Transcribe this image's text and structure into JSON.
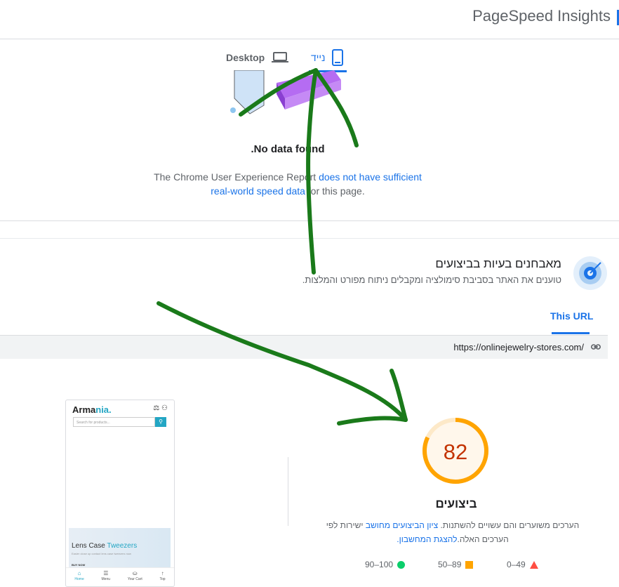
{
  "header": {
    "title": "PageSpeed Insights"
  },
  "device_tabs": {
    "desktop_label": "Desktop",
    "mobile_label": "נייד",
    "selected": "mobile"
  },
  "field_data": {
    "no_data_title": "No data found.",
    "crux_text_1": "The Chrome User Experience Report ",
    "crux_link": "does not have sufficient real-world speed data",
    "crux_text_2": " for this page."
  },
  "diagnose": {
    "title": "מאבחנים בעיות בביצועים",
    "subtitle": "טוענים את האתר בסביבת סימולציה ומקבלים ניתוח מפורט והמלצות."
  },
  "url_tabs": {
    "this_url": "This URL"
  },
  "url_bar": {
    "url": "https://onlinejewelry-stores.com/"
  },
  "thumbnail": {
    "brand_main": "Arma",
    "brand_accent": "nia.",
    "search_placeholder": "Search for products...",
    "banner_title_1": "Lens Case ",
    "banner_title_2": "Tweezers",
    "banner_sub": "Easier close up contact lens case tweezers now",
    "banner_cta": "BUY NOW",
    "nav": [
      "Home",
      "Menu",
      "Your Cart",
      "Top"
    ]
  },
  "score": {
    "value": "82",
    "fraction": 0.82,
    "label": "ביצועים",
    "note_1": "הערכים משוערים והם עשויים להשתנות. ",
    "note_link_1": "ציון הביצועים מחושב",
    "note_2": " ישירות לפי הערכים האלה.",
    "note_link_2": "להצגת המחשבון."
  },
  "legend": {
    "good": "90–100",
    "average": "50–89",
    "poor": "0–49"
  },
  "colors": {
    "accent": "#1a73e8",
    "score_average": "#ffa400",
    "score_text": "#c33300",
    "good": "#0cce6b",
    "poor": "#ff4e42",
    "annotation": "#1a7a1a"
  }
}
